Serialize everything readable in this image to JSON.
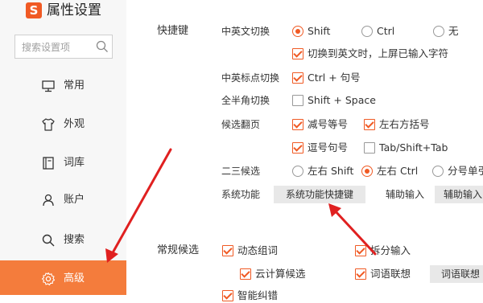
{
  "app": {
    "logo_letter": "S",
    "title": "属性设置"
  },
  "search": {
    "placeholder": "搜索设置项"
  },
  "sidebar": {
    "items": [
      {
        "label": "常用",
        "icon": "monitor-icon"
      },
      {
        "label": "外观",
        "icon": "shirt-icon"
      },
      {
        "label": "词库",
        "icon": "book-icon"
      },
      {
        "label": "账户",
        "icon": "user-icon"
      },
      {
        "label": "搜索",
        "icon": "search-icon"
      },
      {
        "label": "高级",
        "icon": "gear-icon",
        "active": true
      }
    ]
  },
  "shortcuts": {
    "title": "快捷键",
    "cn_en_switch": {
      "label": "中英文切换",
      "options": [
        "Shift",
        "Ctrl",
        "无"
      ],
      "selected": "Shift",
      "commit_checkbox": "切换到英文时，上屏已输入字符"
    },
    "punct_switch": {
      "label": "中英标点切换",
      "value": "Ctrl + 句号"
    },
    "width_switch": {
      "label": "全半角切换",
      "value": "Shift + Space"
    },
    "page_turn": {
      "label": "候选翻页",
      "options": [
        "减号等号",
        "左右方括号",
        "逗号句号",
        "Tab/Shift+Tab"
      ]
    },
    "second_third": {
      "label": "二三候选",
      "options": [
        "左右 Shift",
        "左右 Ctrl",
        "分号单引号"
      ],
      "selected": "左右 Ctrl"
    },
    "system_func": {
      "label": "系统功能",
      "button": "系统功能快捷键"
    },
    "assist_input": {
      "label": "辅助输入",
      "button": "辅助输入"
    }
  },
  "candidates": {
    "title": "常规候选",
    "options": [
      "动态组词",
      "拆分输入",
      "云计算候选",
      "词语联想"
    ],
    "button": "词语联想",
    "partial": "智能纠错"
  },
  "colors": {
    "accent": "#f05a24",
    "active_nav": "#f47c3c",
    "arrow": "#e02020"
  }
}
